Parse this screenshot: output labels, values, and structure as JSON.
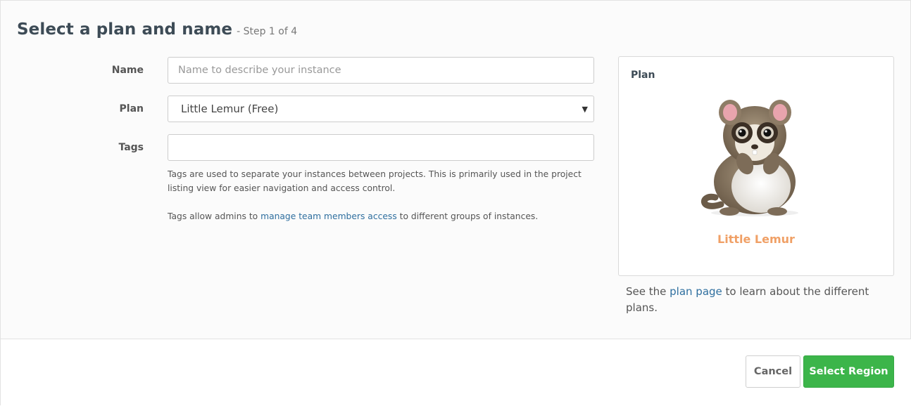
{
  "header": {
    "title": "Select a plan and name",
    "step": "- Step 1 of 4"
  },
  "form": {
    "name": {
      "label": "Name",
      "value": "",
      "placeholder": "Name to describe your instance"
    },
    "plan": {
      "label": "Plan",
      "selected": "Little Lemur (Free)"
    },
    "tags": {
      "label": "Tags",
      "value": ""
    },
    "help": {
      "line1": "Tags are used to separate your instances between projects. This is primarily used in the project listing view for easier navigation and access control.",
      "line2_before": "Tags allow admins to ",
      "line2_link": "manage team members access",
      "line2_after": " to different groups of instances."
    }
  },
  "plan_panel": {
    "title": "Plan",
    "plan_name": "Little Lemur",
    "image": "lemur-mascot",
    "note_before": "See the ",
    "note_link": "plan page",
    "note_after": " to learn about the different plans."
  },
  "footer": {
    "cancel_label": "Cancel",
    "next_label": "Select Region"
  },
  "colors": {
    "primary_button": "#3cb54a",
    "link": "#2f6f9f",
    "plan_name": "#f0a066",
    "title": "#3d4b56"
  }
}
